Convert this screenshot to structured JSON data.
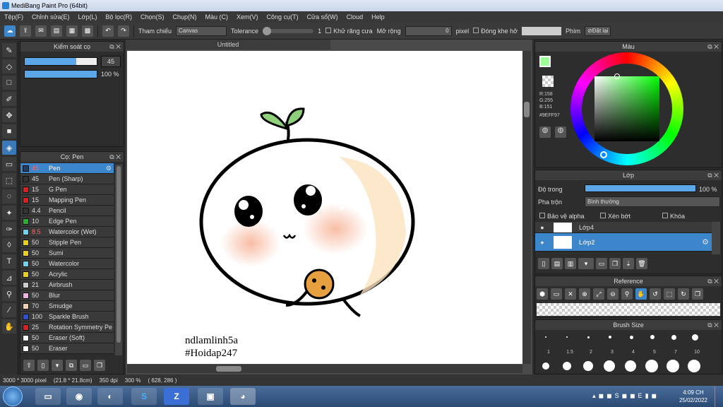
{
  "window": {
    "title": "MediBang Paint Pro (64bit)"
  },
  "menu": [
    "Tệp(F)",
    "Chỉnh sửa(E)",
    "Lớp(L)",
    "Bộ lọc(R)",
    "Chọn(S)",
    "Chụp(N)",
    "Màu (C)",
    "Xem(V)",
    "Công cụ(T)",
    "Cửa sổ(W)",
    "Cloud",
    "Help"
  ],
  "toolbar": {
    "ref_label": "Tham chiếu",
    "ref_value": "Canvas",
    "tolerance_label": "Tolerance",
    "tolerance_value": "1",
    "antialias_label": "Khử răng cưa",
    "expand_label": "Mở rộng",
    "expand_value": "0",
    "pixel_label": "pixel",
    "close_gap_label": "Đóng khe hở",
    "key_label": "Phím",
    "reset_label": "Đặt lại"
  },
  "brush_control": {
    "title": "Kiểm soát cọ",
    "size_value": "45",
    "size_fraction": 0.72,
    "opacity_value": "100 %",
    "opacity_fraction": 1.0
  },
  "brush_panel": {
    "title": "Cọ: Pen",
    "items": [
      {
        "size": "45",
        "name": "Pen",
        "color": "#1e3f6b"
      },
      {
        "size": "45",
        "name": "Pen (Sharp)",
        "color": "#333333"
      },
      {
        "size": "15",
        "name": "G Pen",
        "color": "#d82020"
      },
      {
        "size": "15",
        "name": "Mapping Pen",
        "color": "#d82020"
      },
      {
        "size": "4.4",
        "name": "Pencil",
        "color": "#333333"
      },
      {
        "size": "10",
        "name": "Edge Pen",
        "color": "#2ab02a"
      },
      {
        "size": "8.5",
        "name": "Watercolor (Wet)",
        "color": "#6fd0f0"
      },
      {
        "size": "50",
        "name": "Stipple Pen",
        "color": "#e8d020"
      },
      {
        "size": "50",
        "name": "Sumi",
        "color": "#e8d020"
      },
      {
        "size": "50",
        "name": "Watercolor",
        "color": "#6fd0f0"
      },
      {
        "size": "50",
        "name": "Acrylic",
        "color": "#e8d020"
      },
      {
        "size": "21",
        "name": "Airbrush",
        "color": "#cccccc"
      },
      {
        "size": "50",
        "name": "Blur",
        "color": "#f0b0e0"
      },
      {
        "size": "70",
        "name": "Smudge",
        "color": "#f0d0b0"
      },
      {
        "size": "100",
        "name": "Sparkle Brush",
        "color": "#2a50d0"
      },
      {
        "size": "25",
        "name": "Rotation Symmetry Pe",
        "color": "#d82020"
      },
      {
        "size": "50",
        "name": "Eraser (Soft)",
        "color": "#ffffff"
      },
      {
        "size": "50",
        "name": "Eraser",
        "color": "#ffffff"
      }
    ]
  },
  "document": {
    "tab": "Untitled",
    "caption_line1": "ndlamlinh5a",
    "caption_line2": "#Hoidap247"
  },
  "color_panel": {
    "title": "Màu",
    "r": "R:158",
    "g": "G:255",
    "b": "B:151",
    "hex": "#9EFF97",
    "current_color": "#9EFF97"
  },
  "layer_panel": {
    "title": "Lớp",
    "opacity_label": "Độ trong",
    "opacity_value": "100 %",
    "opacity_fraction": 1.0,
    "blend_label": "Pha trộn",
    "blend_value": "Bình thường",
    "protect_alpha": "Bảo vệ alpha",
    "clipping": "Xén bớt",
    "lock": "Khóa",
    "layers": [
      {
        "name": "Lớp4"
      },
      {
        "name": "Lớp2"
      }
    ]
  },
  "reference_panel": {
    "title": "Reference"
  },
  "brush_size_panel": {
    "title": "Brush Size",
    "sizes": [
      "1",
      "1.5",
      "2",
      "3",
      "4",
      "5",
      "7",
      "10"
    ]
  },
  "status": {
    "size": "3000 * 3000 pixel",
    "physical": "(21.8 * 21.8cm)",
    "dpi": "350 dpi",
    "zoom": "300 %",
    "coords": "( 628, 286 )"
  },
  "taskbar": {
    "time": "4:09 CH",
    "date": "25/02/2022",
    "apps": [
      "explorer",
      "chrome",
      "coccoc",
      "skype",
      "zalo",
      "photos",
      "medibang"
    ]
  }
}
